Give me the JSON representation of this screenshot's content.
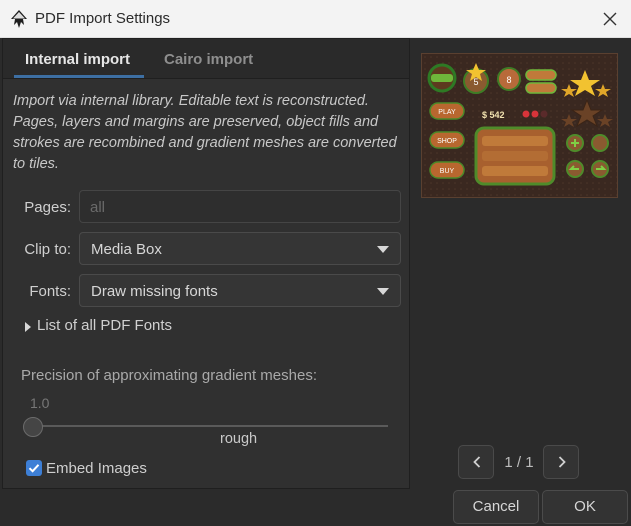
{
  "window": {
    "title": "PDF Import Settings"
  },
  "tabs": [
    {
      "label": "Internal import",
      "active": true
    },
    {
      "label": "Cairo import",
      "active": false
    }
  ],
  "description": "Import via internal library. Editable text is reconstructed. Pages, layers and margins are preserved, object fills and strokes are recombined and gradient meshes are converted to tiles.",
  "pages": {
    "label": "Pages:",
    "placeholder": "all",
    "value": ""
  },
  "clip_to": {
    "label": "Clip to:",
    "selected": "Media Box"
  },
  "fonts": {
    "label": "Fonts:",
    "selected": "Draw missing fonts"
  },
  "font_list": {
    "label": "List of all PDF Fonts",
    "expanded": false
  },
  "precision": {
    "label": "Precision of approximating gradient meshes:",
    "value": "1.0",
    "mark_label": "rough",
    "level": 0.0
  },
  "embed_images": {
    "label": "Embed Images",
    "checked": true
  },
  "preview_page": {
    "current": "1 / 1"
  },
  "buttons": {
    "cancel": "Cancel",
    "ok": "OK"
  },
  "preview_image": {
    "labels": [
      "PLAY",
      "SHOP",
      "BUY"
    ],
    "coin_text": "$ 542",
    "level_number": "5",
    "counter_number": "8"
  },
  "colors": {
    "accent": "#3d6fa3",
    "checkbox": "#3d7fd6",
    "panel_bg": "#303030",
    "window_bg": "#2b2b2b"
  },
  "icons": {
    "app": "inkscape-icon",
    "close": "close-icon",
    "prev": "chevron-left-icon",
    "next": "chevron-right-icon",
    "expander": "triangle-right-icon",
    "combo": "chevron-down-icon"
  }
}
